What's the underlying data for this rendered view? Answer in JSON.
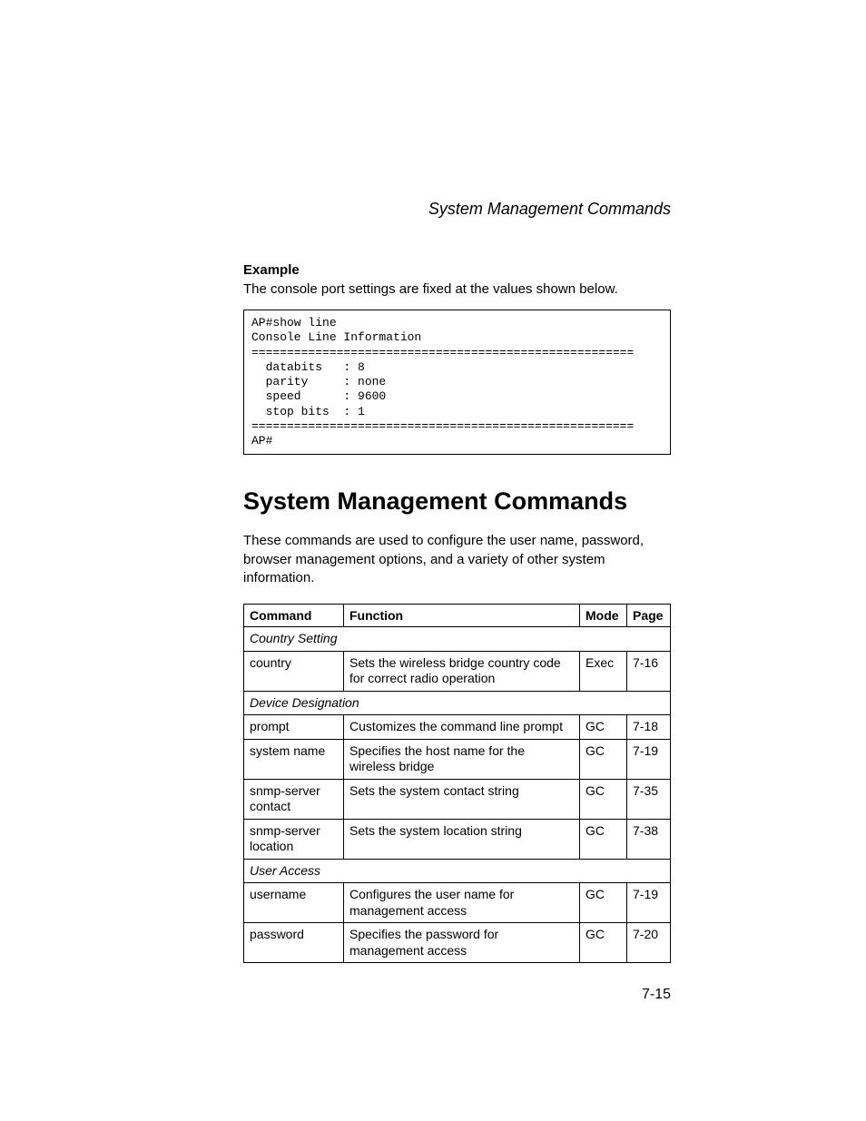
{
  "header": {
    "running_head": "System Management Commands"
  },
  "example": {
    "label": "Example",
    "intro": "The console port settings are fixed at the values shown below.",
    "code": "AP#show line\nConsole Line Information\n======================================================\n  databits   : 8\n  parity     : none\n  speed      : 9600\n  stop bits  : 1\n======================================================\nAP#"
  },
  "section": {
    "title": "System Management Commands",
    "body": "These commands are used to configure the user name, password, browser management options, and a variety of other system information."
  },
  "table": {
    "headers": {
      "command": "Command",
      "function": "Function",
      "mode": "Mode",
      "page": "Page"
    },
    "rows": [
      {
        "type": "group",
        "label": "Country Setting"
      },
      {
        "type": "row",
        "command": "country",
        "function": "Sets the wireless bridge country code for correct radio operation",
        "mode": "Exec",
        "page": "7-16"
      },
      {
        "type": "group",
        "label": "Device Designation"
      },
      {
        "type": "row",
        "command": "prompt",
        "function": "Customizes the command line prompt",
        "mode": "GC",
        "page": "7-18"
      },
      {
        "type": "row",
        "command": "system name",
        "function": "Specifies the host name for the wireless bridge",
        "mode": "GC",
        "page": "7-19"
      },
      {
        "type": "row",
        "command": "snmp-server contact",
        "function": "Sets the system contact string",
        "mode": "GC",
        "page": "7-35"
      },
      {
        "type": "row",
        "command": "snmp-server location",
        "function": "Sets the system location string",
        "mode": "GC",
        "page": "7-38"
      },
      {
        "type": "group",
        "label": "User Access"
      },
      {
        "type": "row",
        "command": "username",
        "function": "Configures the user name for management access",
        "mode": "GC",
        "page": "7-19"
      },
      {
        "type": "row",
        "command": "password",
        "function": "Specifies the password for management access",
        "mode": "GC",
        "page": "7-20"
      }
    ]
  },
  "footer": {
    "page_number": "7-15"
  }
}
